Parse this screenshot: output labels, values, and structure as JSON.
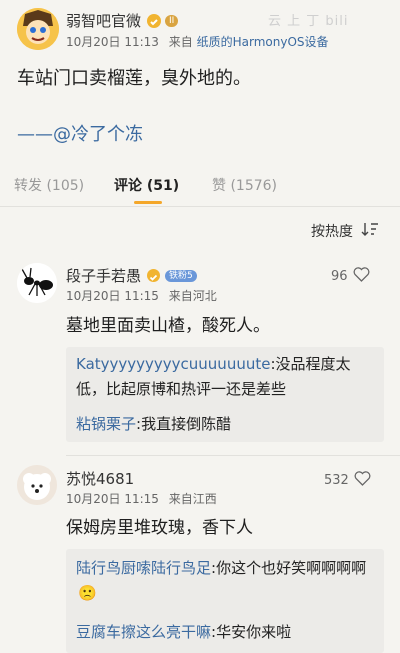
{
  "post": {
    "author": "弱智吧官微",
    "level_badge": "II",
    "date": "10月20日 11:13",
    "source_prefix": "来自",
    "source_device": "纸质的HarmonyOS设备",
    "text": "车站门口卖榴莲，臭外地的。",
    "signature": "——@冷了个冻"
  },
  "tabs": [
    {
      "label": "转发 (105)",
      "active": false
    },
    {
      "label": "评论 (51)",
      "active": true
    },
    {
      "label": "赞 (1576)",
      "active": false
    }
  ],
  "sort": {
    "label": "按热度"
  },
  "comments": [
    {
      "author": "段子手若愚",
      "fan_badge": "铁粉5",
      "date": "10月20日 11:15",
      "source": "来自河北",
      "likes": "96",
      "text": "墓地里面卖山楂，酸死人。",
      "replies": [
        {
          "user": "Katyyyyyyyyycuuuuuuute",
          "text": ":没品程度太低，比起原博和热评一还是差些"
        },
        {
          "user": "粘锅栗子",
          "text": ":我直接倒陈醋"
        }
      ]
    },
    {
      "author": "苏悦4681",
      "date": "10月20日 11:15",
      "source": "来自江西",
      "likes": "532",
      "text": "保姆房里堆玫瑰，香下人",
      "replies": [
        {
          "user": "陆行鸟厨嗦陆行鸟足",
          "text": ":你这个也好笑啊啊啊啊",
          "emoji": "🙁"
        },
        {
          "user": "豆腐车擦这么亮干嘛",
          "text": ":华安你来啦"
        }
      ]
    }
  ],
  "watermark": "云 上 丁 bili",
  "colors": {
    "accent_link": "#3b6aa0",
    "tab_indicator": "#f4a72a",
    "background": "#f5f4f0"
  }
}
